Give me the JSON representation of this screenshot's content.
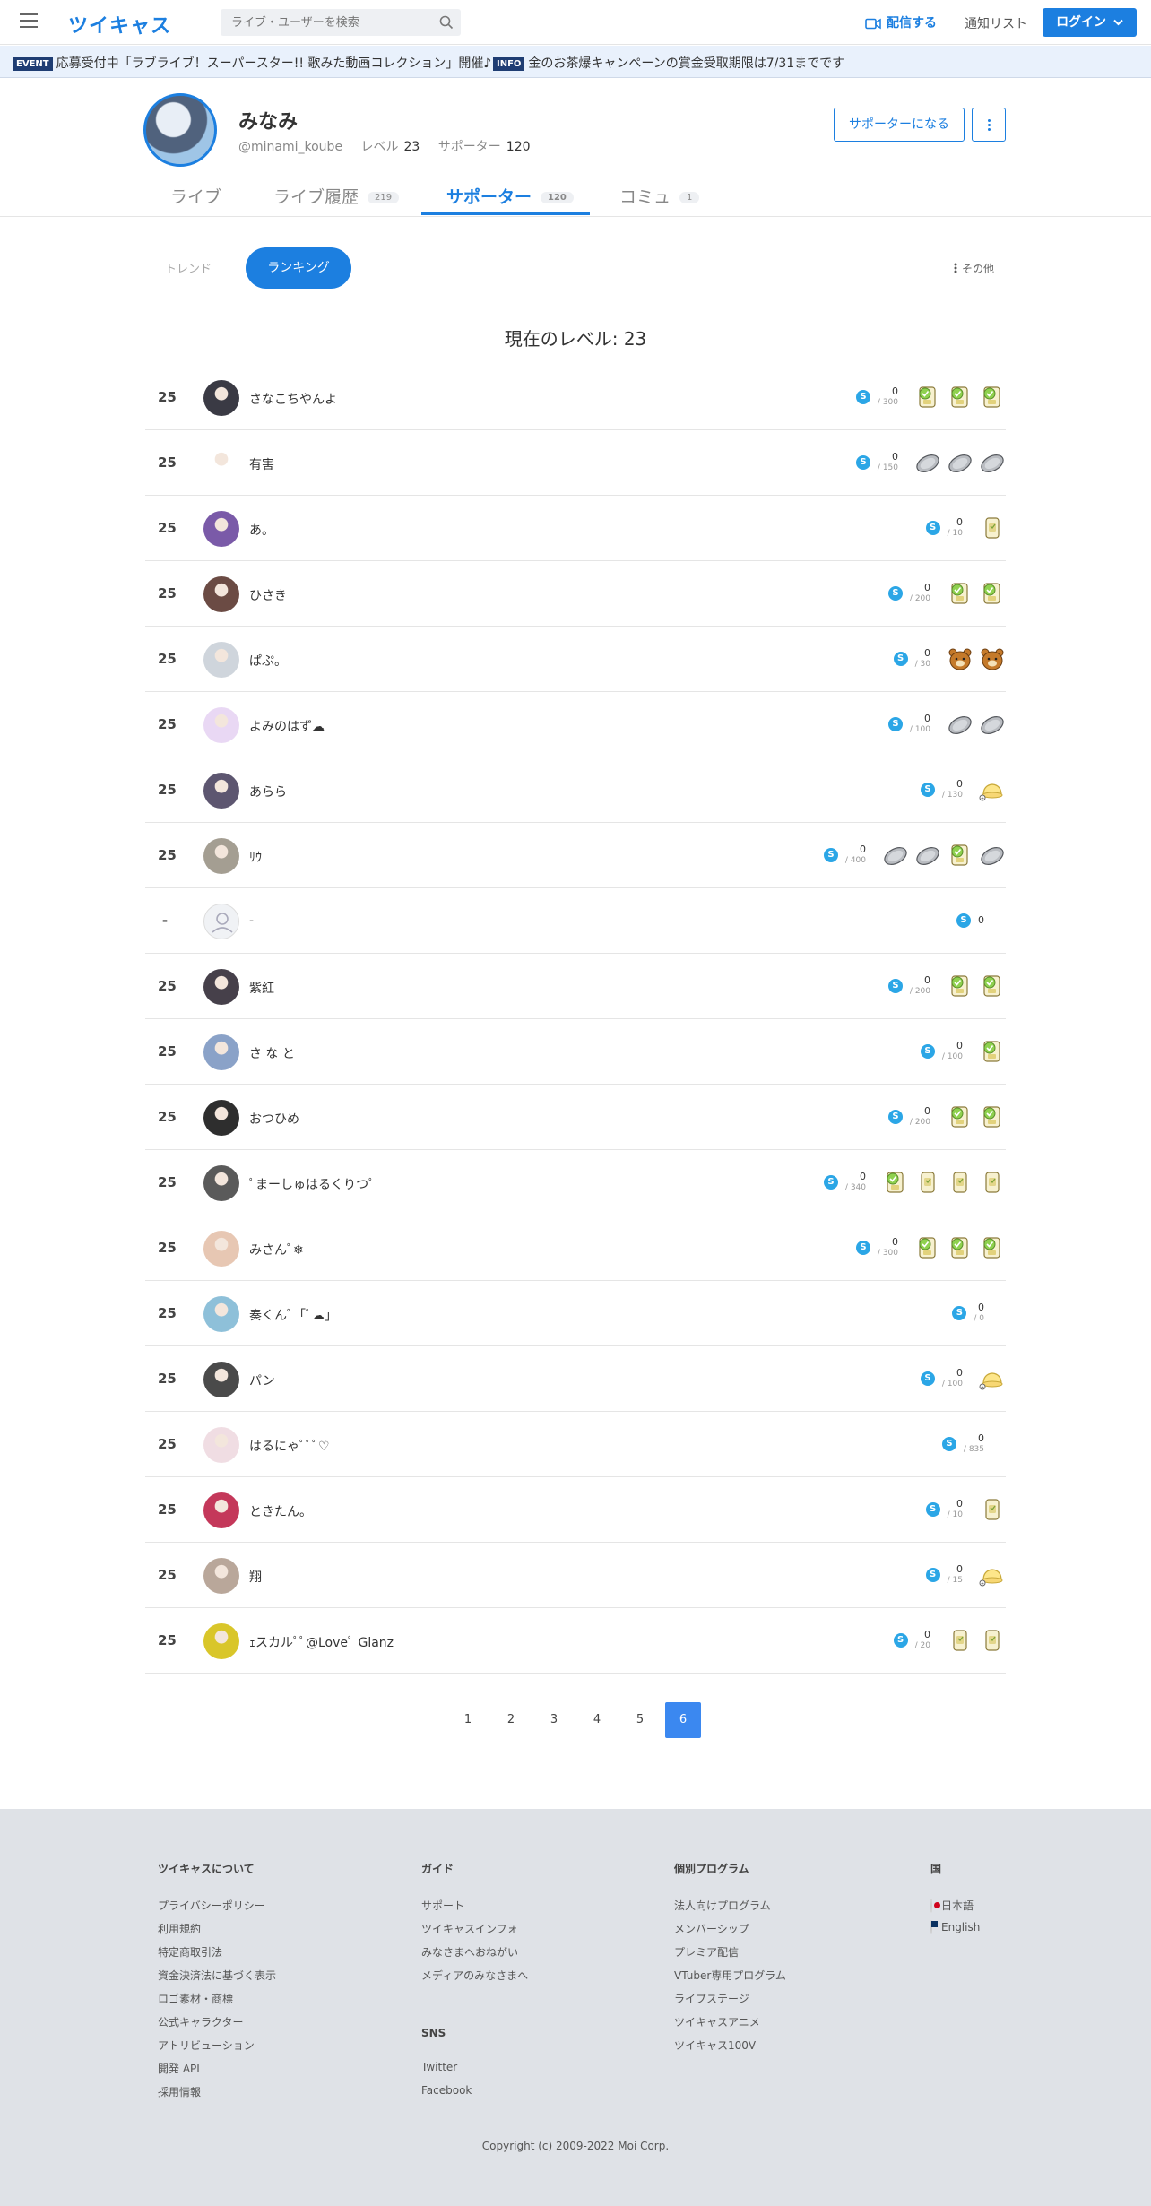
{
  "header": {
    "logo": "ツイキャス",
    "search_placeholder": "ライブ・ユーザーを検索",
    "broadcast_label": "配信する",
    "notify_label": "通知リスト",
    "login_label": "ログイン"
  },
  "ticker": {
    "items": [
      {
        "tag": "EVENT",
        "text": "応募受付中「ラブライブ！スーパースター!! 歌みた動画コレクション」開催♪"
      },
      {
        "tag": "INFO",
        "text": "金のお茶爆キャンペーンの賞金受取期限は7/31までです"
      }
    ]
  },
  "profile": {
    "name": "みなみ",
    "handle": "@minami_koube",
    "level_label": "レベル",
    "level": "23",
    "supporter_label": "サポーター",
    "supporter_count": "120",
    "support_button": "サポーターになる"
  },
  "tabs": [
    {
      "label": "ライブ",
      "count": ""
    },
    {
      "label": "ライブ履歴",
      "count": "219"
    },
    {
      "label": "サポーター",
      "count": "120"
    },
    {
      "label": "コミュ",
      "count": "1"
    }
  ],
  "segment": {
    "trend": "トレンド",
    "ranking": "ランキング",
    "other": "その他"
  },
  "level_title": "現在のレベル: 23",
  "rows": [
    {
      "rank": "25",
      "name": "さなこちやんよ",
      "cur": "0",
      "max": "/ 300",
      "gifts": [
        "tea",
        "tea",
        "tea"
      ],
      "av": "#3a3a44"
    },
    {
      "rank": "25",
      "name": "有害",
      "cur": "0",
      "max": "/ 150",
      "gifts": [
        "coin",
        "coin",
        "coin"
      ],
      "av": "#ffffff"
    },
    {
      "rank": "25",
      "name": "あ。",
      "cur": "0",
      "max": "/ 10",
      "gifts": [
        "cup"
      ],
      "av": "#7a5aa8"
    },
    {
      "rank": "25",
      "name": "ひさき",
      "cur": "0",
      "max": "/ 200",
      "gifts": [
        "tea",
        "tea"
      ],
      "av": "#6b4b44"
    },
    {
      "rank": "25",
      "name": "ぱぷ。",
      "cur": "0",
      "max": "/ 30",
      "gifts": [
        "bear",
        "bear"
      ],
      "av": "#cfd5dc"
    },
    {
      "rank": "25",
      "name": "よみのはず☁︎",
      "cur": "0",
      "max": "/ 100",
      "gifts": [
        "coin",
        "coin"
      ],
      "av": "#e9d8f4"
    },
    {
      "rank": "25",
      "name": "あらら",
      "cur": "0",
      "max": "/ 130",
      "gifts": [
        "pudding"
      ],
      "av": "#5d5670"
    },
    {
      "rank": "25",
      "name": "ﾘｳ",
      "cur": "0",
      "max": "/ 400",
      "gifts": [
        "coin",
        "coin",
        "tea",
        "coin"
      ],
      "av": "#a49e92"
    },
    {
      "rank": "-",
      "name": "-",
      "cur": "0",
      "max": "",
      "gifts": [],
      "av": "#f0f2f5"
    },
    {
      "rank": "25",
      "name": "紫紅",
      "cur": "0",
      "max": "/ 200",
      "gifts": [
        "tea",
        "tea"
      ],
      "av": "#46404a"
    },
    {
      "rank": "25",
      "name": "さ な と",
      "cur": "0",
      "max": "/ 100",
      "gifts": [
        "tea"
      ],
      "av": "#8aa2c8"
    },
    {
      "rank": "25",
      "name": "おつひめ",
      "cur": "0",
      "max": "/ 200",
      "gifts": [
        "tea",
        "tea"
      ],
      "av": "#2e2e2e"
    },
    {
      "rank": "25",
      "name": "ﾟまーしゅはるくりつﾟ",
      "cur": "0",
      "max": "/ 340",
      "gifts": [
        "tea",
        "cup",
        "cup",
        "cup"
      ],
      "av": "#5a5a5a"
    },
    {
      "rank": "25",
      "name": "みさんﾟ❄",
      "cur": "0",
      "max": "/ 300",
      "gifts": [
        "tea",
        "tea",
        "tea"
      ],
      "av": "#e7c7b3"
    },
    {
      "rank": "25",
      "name": "奏くんﾟ「ﾟ☁」",
      "cur": "0",
      "max": "/ 0",
      "gifts": [],
      "av": "#8ec0d9"
    },
    {
      "rank": "25",
      "name": "パン",
      "cur": "0",
      "max": "/ 100",
      "gifts": [
        "pudding"
      ],
      "av": "#4a4a4a"
    },
    {
      "rank": "25",
      "name": "はるにゃﾟﾟﾟ♡",
      "cur": "0",
      "max": "/ 835",
      "gifts": [],
      "av": "#f0dde3"
    },
    {
      "rank": "25",
      "name": "ときたん。",
      "cur": "0",
      "max": "/ 10",
      "gifts": [
        "cup"
      ],
      "av": "#c4385a"
    },
    {
      "rank": "25",
      "name": "翔",
      "cur": "0",
      "max": "/ 15",
      "gifts": [
        "pudding"
      ],
      "av": "#b9a79a"
    },
    {
      "rank": "25",
      "name": "ｪスカルﾟﾟ@Loveﾟ Glanz",
      "cur": "0",
      "max": "/ 20",
      "gifts": [
        "cup",
        "cup"
      ],
      "av": "#d9c62a"
    }
  ],
  "pagination": [
    "1",
    "2",
    "3",
    "4",
    "5",
    "6"
  ],
  "footer": {
    "cols": [
      {
        "title": "ツイキャスについて",
        "links": [
          "プライバシーポリシー",
          "利用規約",
          "特定商取引法",
          "資金決済法に基づく表示",
          "ロゴ素材・商標",
          "公式キャラクター",
          "アトリビューション",
          "開発 API",
          "採用情報"
        ]
      },
      {
        "title": "ガイド",
        "links": [
          "サポート",
          "ツイキャスインフォ",
          "みなさまへおねがい",
          "メディアのみなさまへ"
        ]
      },
      {
        "title": "個別プログラム",
        "links": [
          "法人向けプログラム",
          "メンバーシップ",
          "プレミア配信",
          "VTuber専用プログラム",
          "ライブステージ",
          "ツイキャスアニメ",
          "ツイキャス100V"
        ]
      },
      {
        "title": "国",
        "links": [
          "日本語",
          "English"
        ]
      }
    ],
    "sns_title": "SNS",
    "sns_links": [
      "Twitter",
      "Facebook"
    ],
    "copyright": "Copyright (c) 2009-2022 Moi Corp."
  },
  "colors": {
    "accent": "#1c7fe0",
    "coin": "#2ba6e6",
    "footer_bg": "#dfe2e7"
  }
}
